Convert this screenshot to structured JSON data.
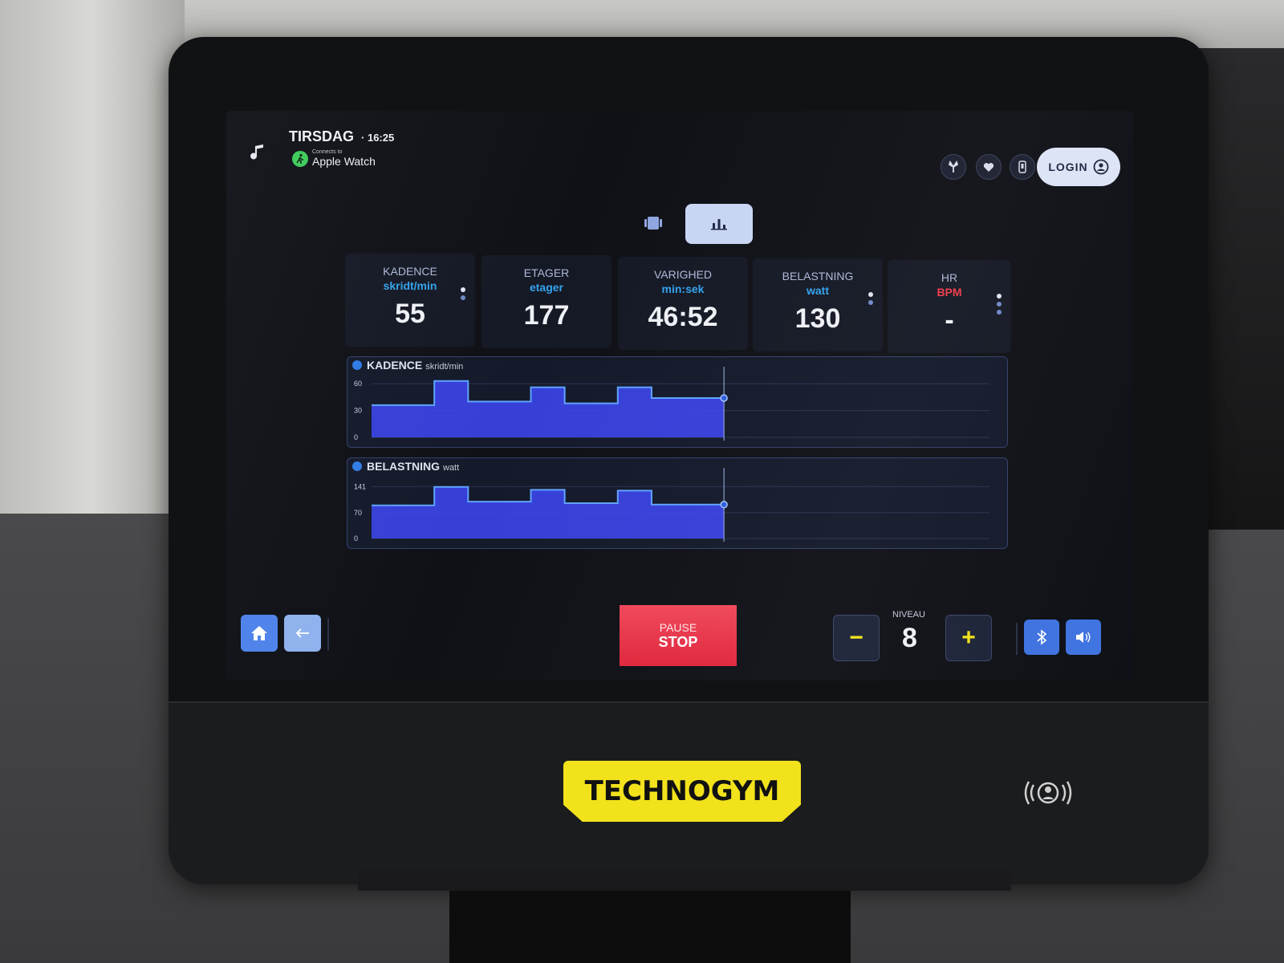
{
  "header": {
    "day": "TIRSDAG",
    "time": "16:25",
    "watch_connect_sub": "Connects to",
    "watch_name": "Apple Watch",
    "login_label": "LOGIN"
  },
  "icons": {
    "music": "music-note-icon",
    "fan": "fan-icon",
    "heart": "heart-icon",
    "phone": "phone-icon",
    "user": "user-icon",
    "home": "home-icon",
    "back": "arrow-left-icon",
    "bluetooth": "bluetooth-icon",
    "volume": "volume-icon"
  },
  "metrics": [
    {
      "label": "KADENCE",
      "unit": "skridt/min",
      "value": "55"
    },
    {
      "label": "ETAGER",
      "unit": "etager",
      "value": "177"
    },
    {
      "label": "VARIGHED",
      "unit": "min:sek",
      "value": "46:52"
    },
    {
      "label": "BELASTNING",
      "unit": "watt",
      "value": "130"
    },
    {
      "label": "HR",
      "unit": "BPM",
      "value": "-"
    }
  ],
  "charts": {
    "cadence": {
      "title": "KADENCE",
      "unit": "skridt/min",
      "ticks": [
        "60",
        "30",
        "0"
      ]
    },
    "load": {
      "title": "BELASTNING",
      "unit": "watt",
      "ticks": [
        "141",
        "70",
        "0"
      ]
    }
  },
  "controls": {
    "pause_label": "PAUSE",
    "stop_label": "STOP",
    "niveau_label": "NIVEAU",
    "niveau_value": "8",
    "minus_label": "−",
    "plus_label": "+"
  },
  "brand": {
    "logo_text": "TECHNOGYM"
  },
  "colors": {
    "accent_blue": "#2f7be6",
    "chart_fill": "#3b46ef",
    "stop_red": "#e0253c",
    "logo_yellow": "#f2e21c",
    "cadence_unit": "#34a3ee",
    "hr_unit": "#ef3b47"
  },
  "chart_data": [
    {
      "type": "area",
      "title": "KADENCE",
      "ylabel": "skridt/min",
      "ylim": [
        0,
        70
      ],
      "yticks": [
        0,
        30,
        60
      ],
      "x": [
        0,
        13,
        13,
        20,
        20,
        33,
        33,
        40,
        40,
        51,
        51,
        58,
        58,
        73
      ],
      "series": [
        {
          "values": [
            36,
            36,
            63,
            63,
            40,
            40,
            56,
            56,
            38,
            38,
            56,
            56,
            44,
            44
          ]
        }
      ],
      "grid": true
    },
    {
      "type": "area",
      "title": "BELASTNING",
      "ylabel": "watt",
      "ylim": [
        0,
        170
      ],
      "yticks": [
        0,
        70,
        141
      ],
      "x": [
        0,
        13,
        13,
        20,
        20,
        33,
        33,
        40,
        40,
        51,
        51,
        58,
        58,
        73
      ],
      "series": [
        {
          "values": [
            90,
            90,
            140,
            140,
            100,
            100,
            132,
            132,
            96,
            96,
            130,
            130,
            92,
            92
          ]
        }
      ],
      "grid": true
    }
  ]
}
